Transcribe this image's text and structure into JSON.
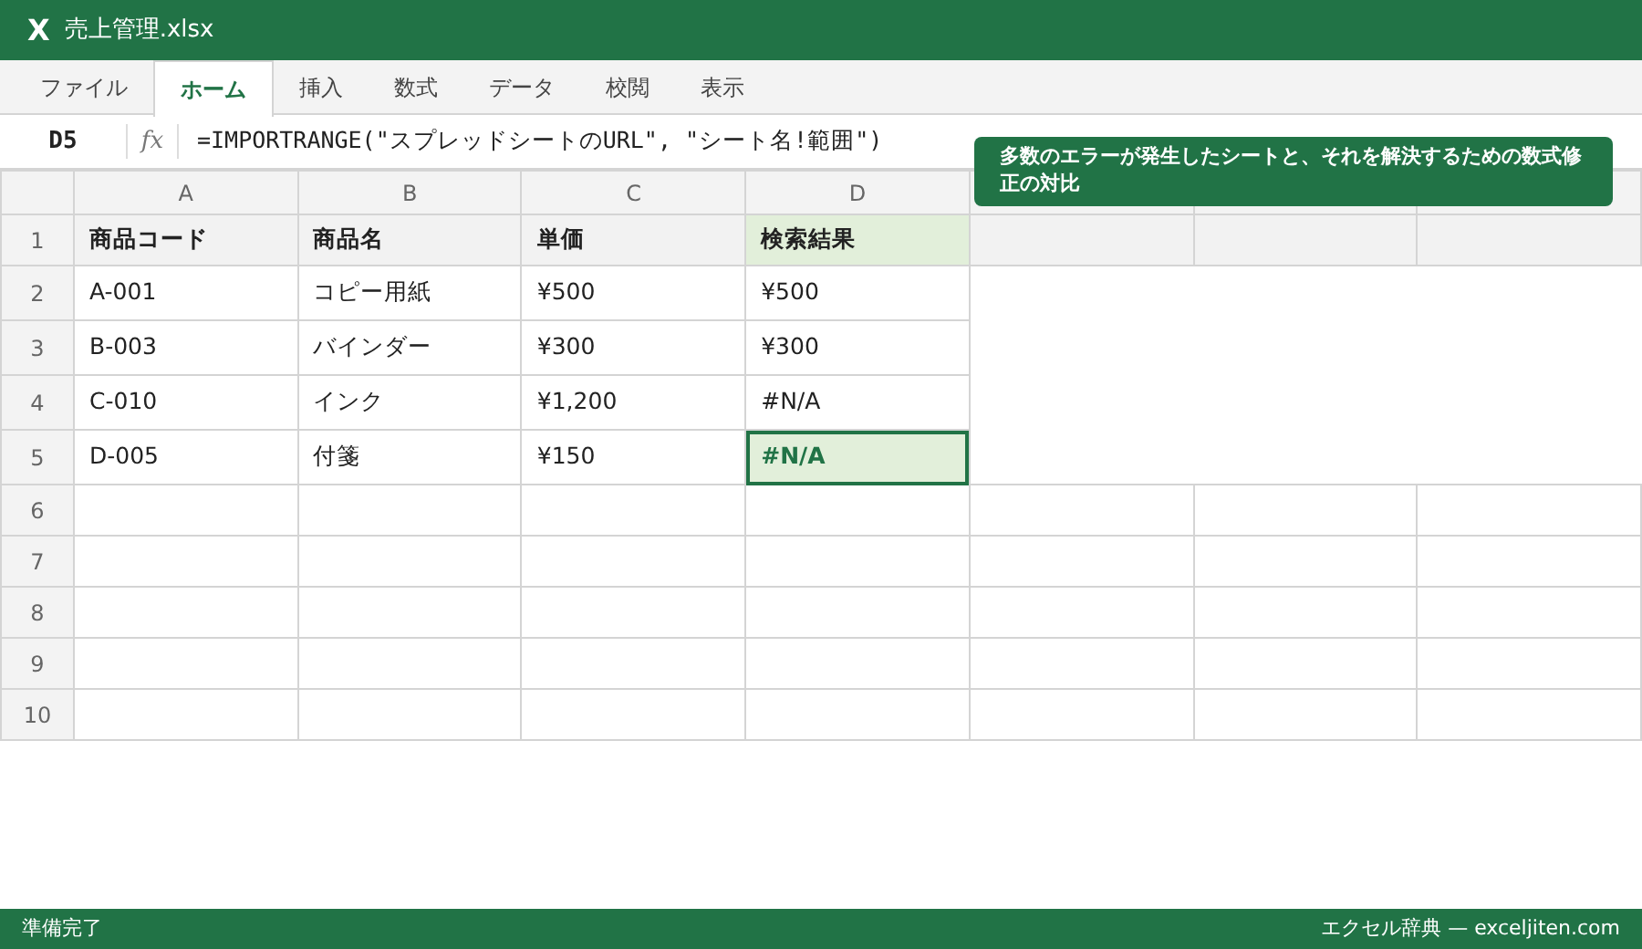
{
  "window": {
    "app_icon": "X",
    "title": "売上管理.xlsx"
  },
  "tabs": [
    {
      "label": "ファイル",
      "selected": false
    },
    {
      "label": "ホーム",
      "selected": true
    },
    {
      "label": "挿入",
      "selected": false
    },
    {
      "label": "数式",
      "selected": false
    },
    {
      "label": "データ",
      "selected": false
    },
    {
      "label": "校閲",
      "selected": false
    },
    {
      "label": "表示",
      "selected": false
    }
  ],
  "formula_bar": {
    "cell_ref": "D5",
    "fx": "fx",
    "formula": "=IMPORTRANGE(\"スプレッドシートのURL\", \"シート名!範囲\")"
  },
  "tooltip": "多数のエラーが発生したシートと、それを解決するための数式修正の対比",
  "sheet": {
    "columns": [
      "A",
      "B",
      "C",
      "D"
    ],
    "rows": [
      {
        "number": "1",
        "kind": "header",
        "cells": [
          {
            "text": "商品コード",
            "selected": false,
            "highlight": false
          },
          {
            "text": "商品名",
            "selected": false,
            "highlight": false
          },
          {
            "text": "単価",
            "selected": false,
            "highlight": false
          },
          {
            "text": "検索結果",
            "selected": false,
            "highlight": true
          }
        ]
      },
      {
        "number": "2",
        "kind": "data",
        "cells": [
          {
            "text": "A-001",
            "selected": false,
            "highlight": false
          },
          {
            "text": "コピー用紙",
            "selected": false,
            "highlight": false
          },
          {
            "text": "¥500",
            "selected": false,
            "highlight": false
          },
          {
            "text": "¥500",
            "selected": false,
            "highlight": false
          }
        ]
      },
      {
        "number": "3",
        "kind": "data",
        "cells": [
          {
            "text": "B-003",
            "selected": false,
            "highlight": false
          },
          {
            "text": "バインダー",
            "selected": false,
            "highlight": false
          },
          {
            "text": "¥300",
            "selected": false,
            "highlight": false
          },
          {
            "text": "¥300",
            "selected": false,
            "highlight": false
          }
        ]
      },
      {
        "number": "4",
        "kind": "data",
        "cells": [
          {
            "text": "C-010",
            "selected": false,
            "highlight": false
          },
          {
            "text": "インク",
            "selected": false,
            "highlight": false
          },
          {
            "text": "¥1,200",
            "selected": false,
            "highlight": false
          },
          {
            "text": "#N/A",
            "selected": false,
            "highlight": false
          }
        ]
      },
      {
        "number": "5",
        "kind": "data",
        "cells": [
          {
            "text": "D-005",
            "selected": false,
            "highlight": false
          },
          {
            "text": "付箋",
            "selected": false,
            "highlight": false
          },
          {
            "text": "¥150",
            "selected": false,
            "highlight": false
          },
          {
            "text": "#N/A",
            "selected": true,
            "highlight": false
          }
        ]
      },
      {
        "number": "6",
        "kind": "empty",
        "cells": []
      },
      {
        "number": "7",
        "kind": "empty",
        "cells": []
      },
      {
        "number": "8",
        "kind": "empty",
        "cells": []
      },
      {
        "number": "9",
        "kind": "empty",
        "cells": []
      },
      {
        "number": "10",
        "kind": "empty",
        "cells": []
      }
    ]
  },
  "status_bar": {
    "left": "準備完了",
    "right": "エクセル辞典 — exceljiten.com"
  }
}
